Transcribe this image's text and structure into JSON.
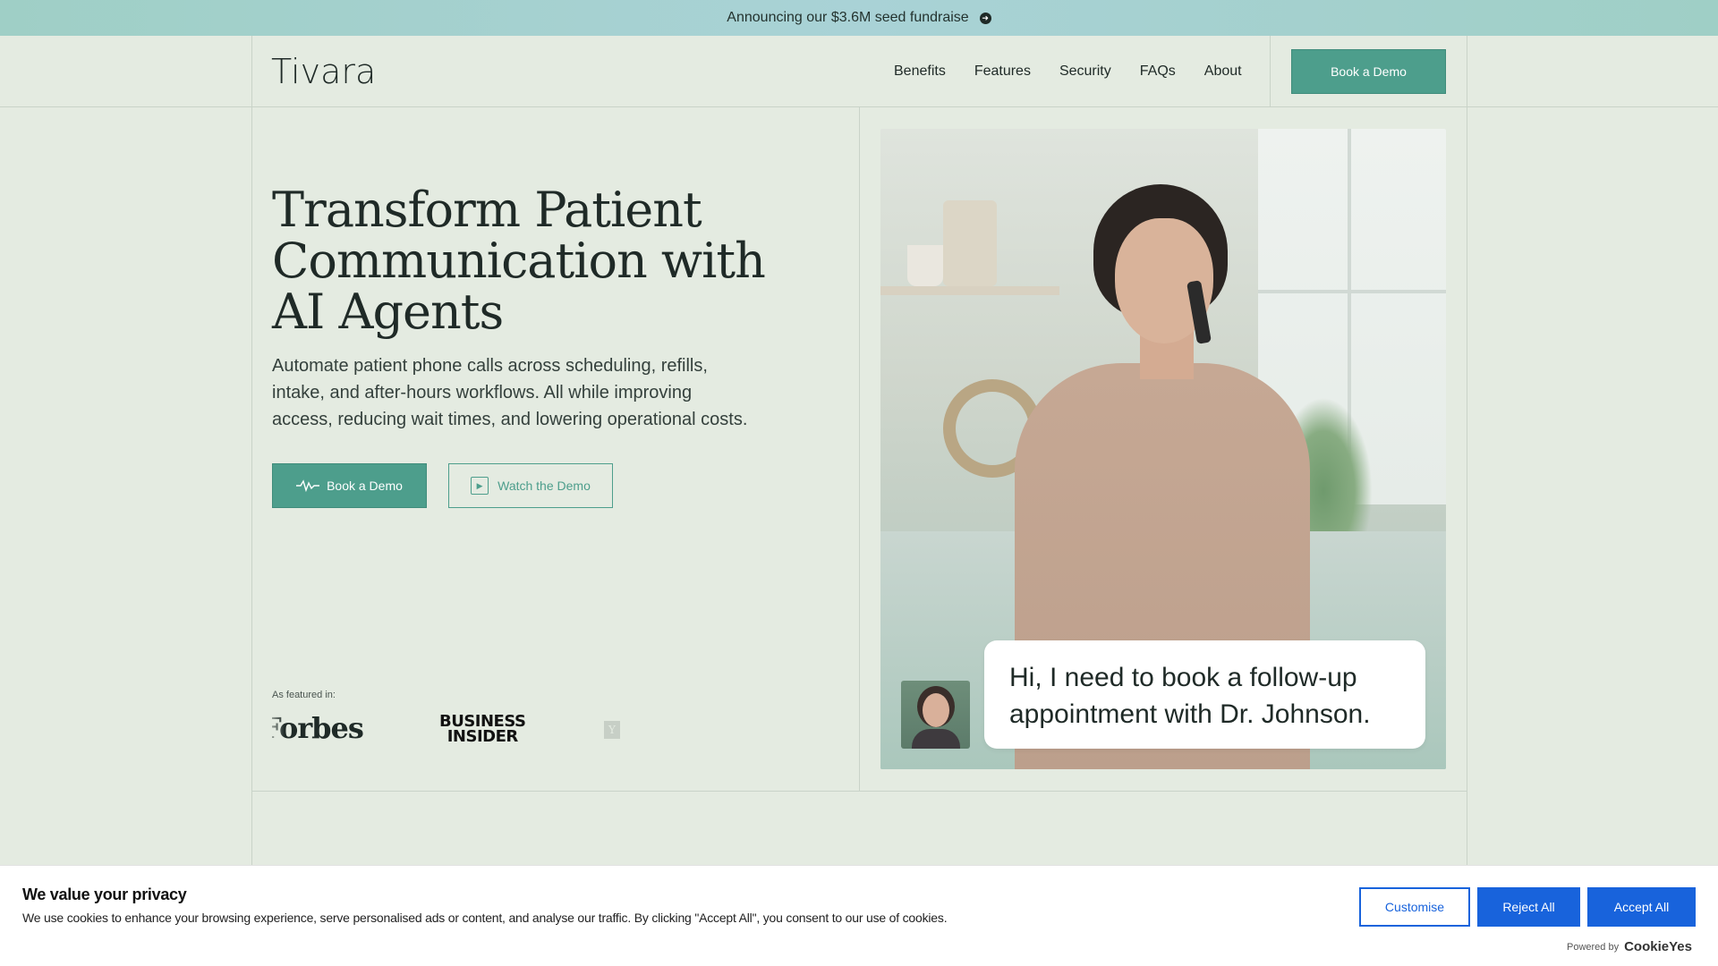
{
  "announcement": {
    "text": "Announcing our $3.6M seed fundraise",
    "icon": "arrow-right-icon"
  },
  "header": {
    "logo": "Tivara",
    "nav": [
      "Benefits",
      "Features",
      "Security",
      "FAQs",
      "About"
    ],
    "cta_label": "Book a Demo"
  },
  "hero": {
    "title": "Transform Patient Communication with AI Agents",
    "subtitle": "Automate patient phone calls across scheduling, refills, intake, and after-hours workflows. All while improving access, reducing wait times, and lowering operational costs.",
    "primary_button": "Book a Demo",
    "primary_icon": "waveform-icon",
    "secondary_button": "Watch the Demo",
    "secondary_icon": "play-icon",
    "featured_label": "As featured in:",
    "featured_logos": [
      "Forbes",
      "BUSINESS INSIDER",
      "Y"
    ]
  },
  "chat": {
    "message": "Hi, I need to book a follow-up appointment with Dr. Johnson."
  },
  "cookie": {
    "title": "We value your privacy",
    "text": "We use cookies to enhance your browsing experience, serve personalised ads or content, and analyse our traffic. By clicking \"Accept All\", you consent to our use of cookies.",
    "customise": "Customise",
    "reject": "Reject All",
    "accept": "Accept All",
    "powered_by": "Powered by",
    "brand": "CookieYes"
  },
  "colors": {
    "page_bg": "#e4ebe1",
    "accent": "#4d9e8c",
    "cookie_blue": "#1863dc"
  }
}
